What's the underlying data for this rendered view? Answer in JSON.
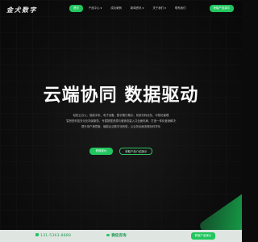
{
  "brand": {
    "logo_text": "金犬数字"
  },
  "nav": {
    "items": [
      {
        "label": "首页",
        "active": true,
        "dropdown": false
      },
      {
        "label": "产品中心",
        "active": false,
        "dropdown": true
      },
      {
        "label": "成功案例",
        "active": false,
        "dropdown": false
      },
      {
        "label": "新闻资讯",
        "active": false,
        "dropdown": true
      },
      {
        "label": "关于我们",
        "active": false,
        "dropdown": true
      },
      {
        "label": "联系我们",
        "active": false,
        "dropdown": false
      }
    ],
    "cta_label": "获取产品演示"
  },
  "hero": {
    "title": "云端协同 数据驱动",
    "description": [
      "轻松云办公，智能手机、电子设备、数字展厅展示、系统代码优化、可视化管理",
      "智慧型科技多元化场景服务，专属数据资源与营销流量入口全面布局，打造一体化营销解决",
      "提升用户满意度，赋能企业数字化转型，让业务全面流程化科学化"
    ],
    "primary_button": "获取报价",
    "secondary_button": "获取产品介绍演示"
  },
  "footer": {
    "phone": "131-5363-8888",
    "wechat_label": "微信咨询",
    "cta_label": "获取产品演示"
  },
  "colors": {
    "accent": "#22c55e",
    "background": "#0b0b0b",
    "footer_bg": "#dfe5e1"
  }
}
